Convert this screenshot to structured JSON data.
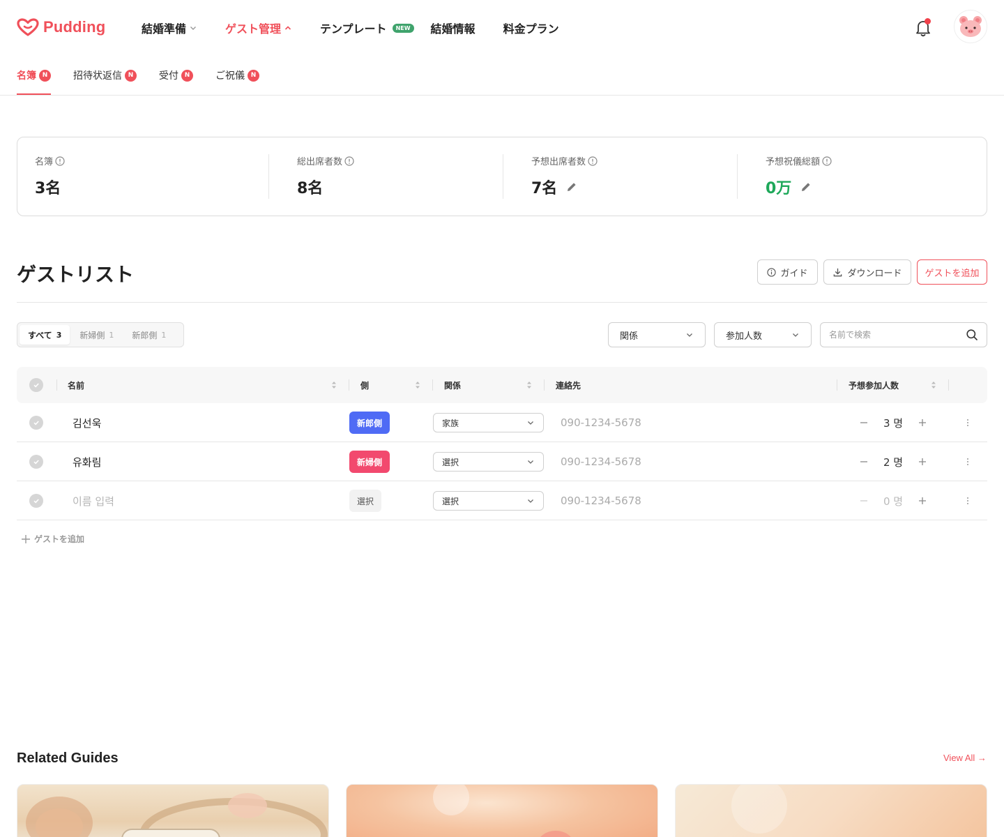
{
  "brand": {
    "name": "Pudding",
    "color": "#f0505a"
  },
  "nav": {
    "items": [
      {
        "label": "結婚準備",
        "chevron": "down"
      },
      {
        "label": "ゲスト管理",
        "chevron": "up",
        "active": true
      },
      {
        "label": "テンプレート",
        "badge": "NEW"
      },
      {
        "label": "結婚情報"
      },
      {
        "label": "料金プラン"
      }
    ]
  },
  "subtabs": [
    {
      "label": "名簿",
      "badge": "N",
      "active": true
    },
    {
      "label": "招待状返信",
      "badge": "N"
    },
    {
      "label": "受付",
      "badge": "N"
    },
    {
      "label": "ご祝儀",
      "badge": "N"
    }
  ],
  "summary": {
    "roster": {
      "label": "名簿",
      "value": "3名"
    },
    "total_attendees": {
      "label": "総出席者数",
      "value": "8名"
    },
    "expected_attendees": {
      "label": "予想出席者数",
      "value": "7名"
    },
    "expected_gift": {
      "label": "予想祝儀総額",
      "value": "0万"
    }
  },
  "guest_list": {
    "title": "ゲストリスト",
    "buttons": {
      "guide": "ガイド",
      "download": "ダウンロード",
      "add": "ゲストを追加"
    },
    "filters": {
      "segments": [
        {
          "label": "すべて",
          "count": "3",
          "active": true
        },
        {
          "label": "新婦側",
          "count": "1"
        },
        {
          "label": "新郎側",
          "count": "1"
        }
      ],
      "relation_dropdown": "関係",
      "attendees_dropdown": "参加人数",
      "search_placeholder": "名前で検索"
    },
    "columns": {
      "name": "名前",
      "side": "側",
      "relation": "関係",
      "contact": "連絡先",
      "expected": "予想参加人数"
    },
    "rows": [
      {
        "name": "김선욱",
        "side": "新郎側",
        "side_color": "#4f6bf5",
        "relation": "家族",
        "phone": "090-1234-5678",
        "count": "3 명"
      },
      {
        "name": "유화림",
        "side": "新婦側",
        "side_color": "#f2496e",
        "relation": "選択",
        "phone": "090-1234-5678",
        "count": "2 명"
      },
      {
        "name": "이름 입력",
        "side": "選択",
        "side_color": "#f2f2f2",
        "relation": "選択",
        "phone": "090-1234-5678",
        "count": "0 명"
      }
    ],
    "add_row_label": "ゲストを追加"
  },
  "related_guides": {
    "title": "Related Guides",
    "view_all": "View All →"
  }
}
